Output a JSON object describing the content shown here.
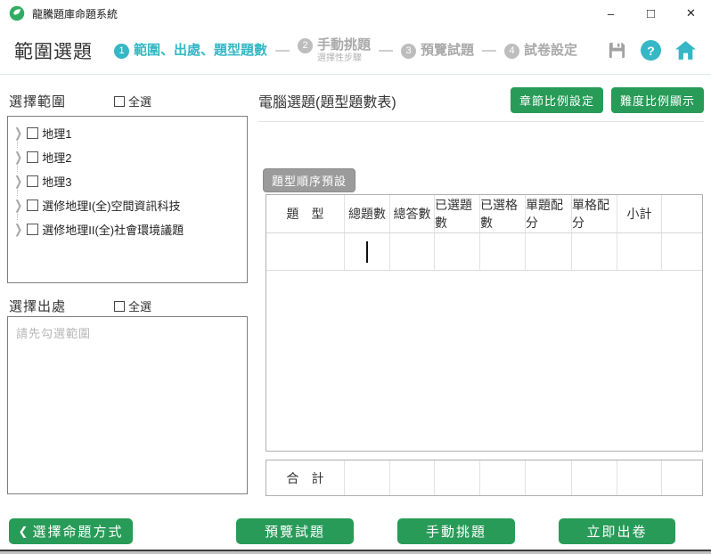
{
  "window": {
    "title": "龍騰題庫命題系統",
    "minimize": "–",
    "maximize": "□",
    "close": "✕"
  },
  "colors": {
    "green": "#289b58",
    "teal": "#35b7c5",
    "gray_button": "#9b9b9b"
  },
  "header": {
    "page_title": "範圍選題",
    "steps": [
      {
        "num": "1",
        "label": "範圍、出處、題型題數",
        "sub": ""
      },
      {
        "num": "2",
        "label": "手動挑題",
        "sub": "選擇性步驟"
      },
      {
        "num": "3",
        "label": "預覽試題",
        "sub": ""
      },
      {
        "num": "4",
        "label": "試卷設定",
        "sub": ""
      }
    ],
    "help_glyph": "?"
  },
  "sidebar": {
    "range": {
      "title": "選擇範圍",
      "select_all": "全選",
      "items": [
        "地理1",
        "地理2",
        "地理3",
        "選修地理I(全)空間資訊科技",
        "選修地理II(全)社會環境議題"
      ]
    },
    "source": {
      "title": "選擇出處",
      "select_all": "全選",
      "placeholder": "請先勾選範圍"
    }
  },
  "main": {
    "title": "電腦選題(題型題數表)",
    "chapter_ratio_btn": "章節比例設定",
    "difficulty_ratio_btn": "難度比例顯示",
    "type_order_btn": "題型順序預設",
    "table": {
      "headers": [
        "題　型",
        "總題數",
        "總答數",
        "已選題數",
        "已選格數",
        "單題配分",
        "單格配分",
        "小計"
      ],
      "rows": [
        [
          "",
          "",
          "",
          "",
          "",
          "",
          "",
          "",
          ""
        ]
      ],
      "total_label": "合　計"
    }
  },
  "footer": {
    "back_icon": "❮",
    "back": "選擇命題方式",
    "preview": "預覽試題",
    "manual": "手動挑題",
    "generate": "立即出卷"
  }
}
